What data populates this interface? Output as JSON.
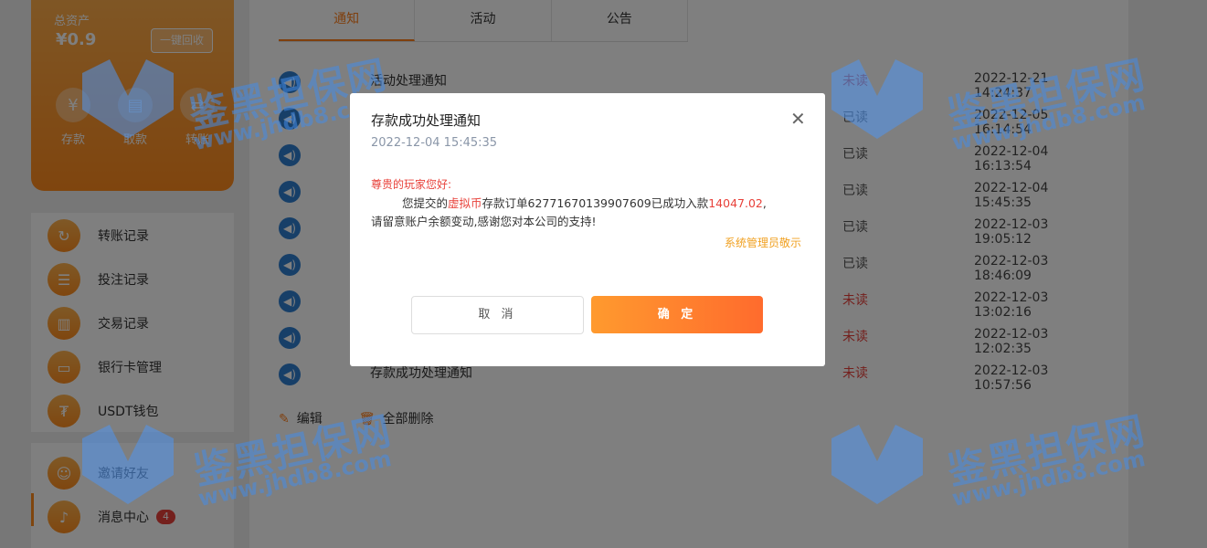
{
  "sidebar": {
    "asset_label": "总资产",
    "asset_amount": "¥0.9",
    "recycle_button": "一键回收",
    "actions": [
      {
        "label": "存款",
        "icon": "deposit-icon",
        "glyph": "¥"
      },
      {
        "label": "取款",
        "icon": "withdraw-icon",
        "glyph": "▤"
      },
      {
        "label": "转账",
        "icon": "transfer-icon",
        "glyph": "⇄"
      }
    ],
    "menu": [
      {
        "label": "转账记录",
        "icon": "transfer-record-icon",
        "glyph": "↻"
      },
      {
        "label": "投注记录",
        "icon": "bet-record-icon",
        "glyph": "☰"
      },
      {
        "label": "交易记录",
        "icon": "trade-record-icon",
        "glyph": "▥"
      },
      {
        "label": "银行卡管理",
        "icon": "bank-card-icon",
        "glyph": "▭"
      },
      {
        "label": "USDT钱包",
        "icon": "usdt-wallet-icon",
        "glyph": "₮"
      }
    ],
    "menu2": [
      {
        "label": "邀请好友",
        "icon": "invite-friend-icon",
        "glyph": "☺"
      },
      {
        "label": "消息中心",
        "icon": "message-bell-icon",
        "glyph": "♪",
        "badge": "4"
      }
    ]
  },
  "tabs": [
    "通知",
    "活动",
    "公告"
  ],
  "active_tab": 0,
  "messages": [
    {
      "title": "活动处理通知",
      "status": "未读",
      "unread": true,
      "time": "2022-12-21 14:24:37"
    },
    {
      "title": "",
      "status": "已读",
      "unread": false,
      "time": "2022-12-05 16:14:54"
    },
    {
      "title": "",
      "status": "已读",
      "unread": false,
      "time": "2022-12-04 16:13:54"
    },
    {
      "title": "",
      "status": "已读",
      "unread": false,
      "time": "2022-12-04 15:45:35"
    },
    {
      "title": "",
      "status": "已读",
      "unread": false,
      "time": "2022-12-03 19:05:12"
    },
    {
      "title": "",
      "status": "已读",
      "unread": false,
      "time": "2022-12-03 18:46:09"
    },
    {
      "title": "",
      "status": "未读",
      "unread": true,
      "time": "2022-12-03 13:02:16"
    },
    {
      "title": "",
      "status": "未读",
      "unread": true,
      "time": "2022-12-03 12:02:35"
    },
    {
      "title": "存款成功处理通知",
      "status": "未读",
      "unread": true,
      "time": "2022-12-03 10:57:56"
    }
  ],
  "bottom_actions": {
    "edit": "编辑",
    "delete_all": "全部删除"
  },
  "modal": {
    "title": "存款成功处理通知",
    "date": "2022-12-04 15:45:35",
    "greeting": "尊贵的玩家您好:",
    "body_prefix": "您提交的",
    "currency": "虚拟币",
    "body_mid": "存款订单62771670139907609已成功入款",
    "amount": "14047.02",
    "body_suffix": ",",
    "body_line2": "请留意账户余额变动,感谢您对本公司的支持!",
    "signature": "系统管理员敬示",
    "cancel": "取 消",
    "ok": "确 定",
    "close_glyph": "✕"
  },
  "watermark": {
    "title": "鉴黑担保网",
    "url": "www.jhdb8.com"
  },
  "colors": {
    "accent": "#ff7e1b",
    "unread": "#e8413a",
    "watermark": "#468ce6"
  }
}
